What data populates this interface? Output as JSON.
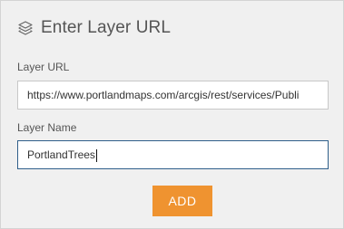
{
  "header": {
    "icon": "layers-icon",
    "title": "Enter Layer URL"
  },
  "url_field": {
    "label": "Layer URL",
    "value": "https://www.portlandmaps.com/arcgis/rest/services/Publi"
  },
  "name_field": {
    "label": "Layer Name",
    "value": "PortlandTrees"
  },
  "add_button": {
    "label": "ADD",
    "color": "#ef9330"
  }
}
